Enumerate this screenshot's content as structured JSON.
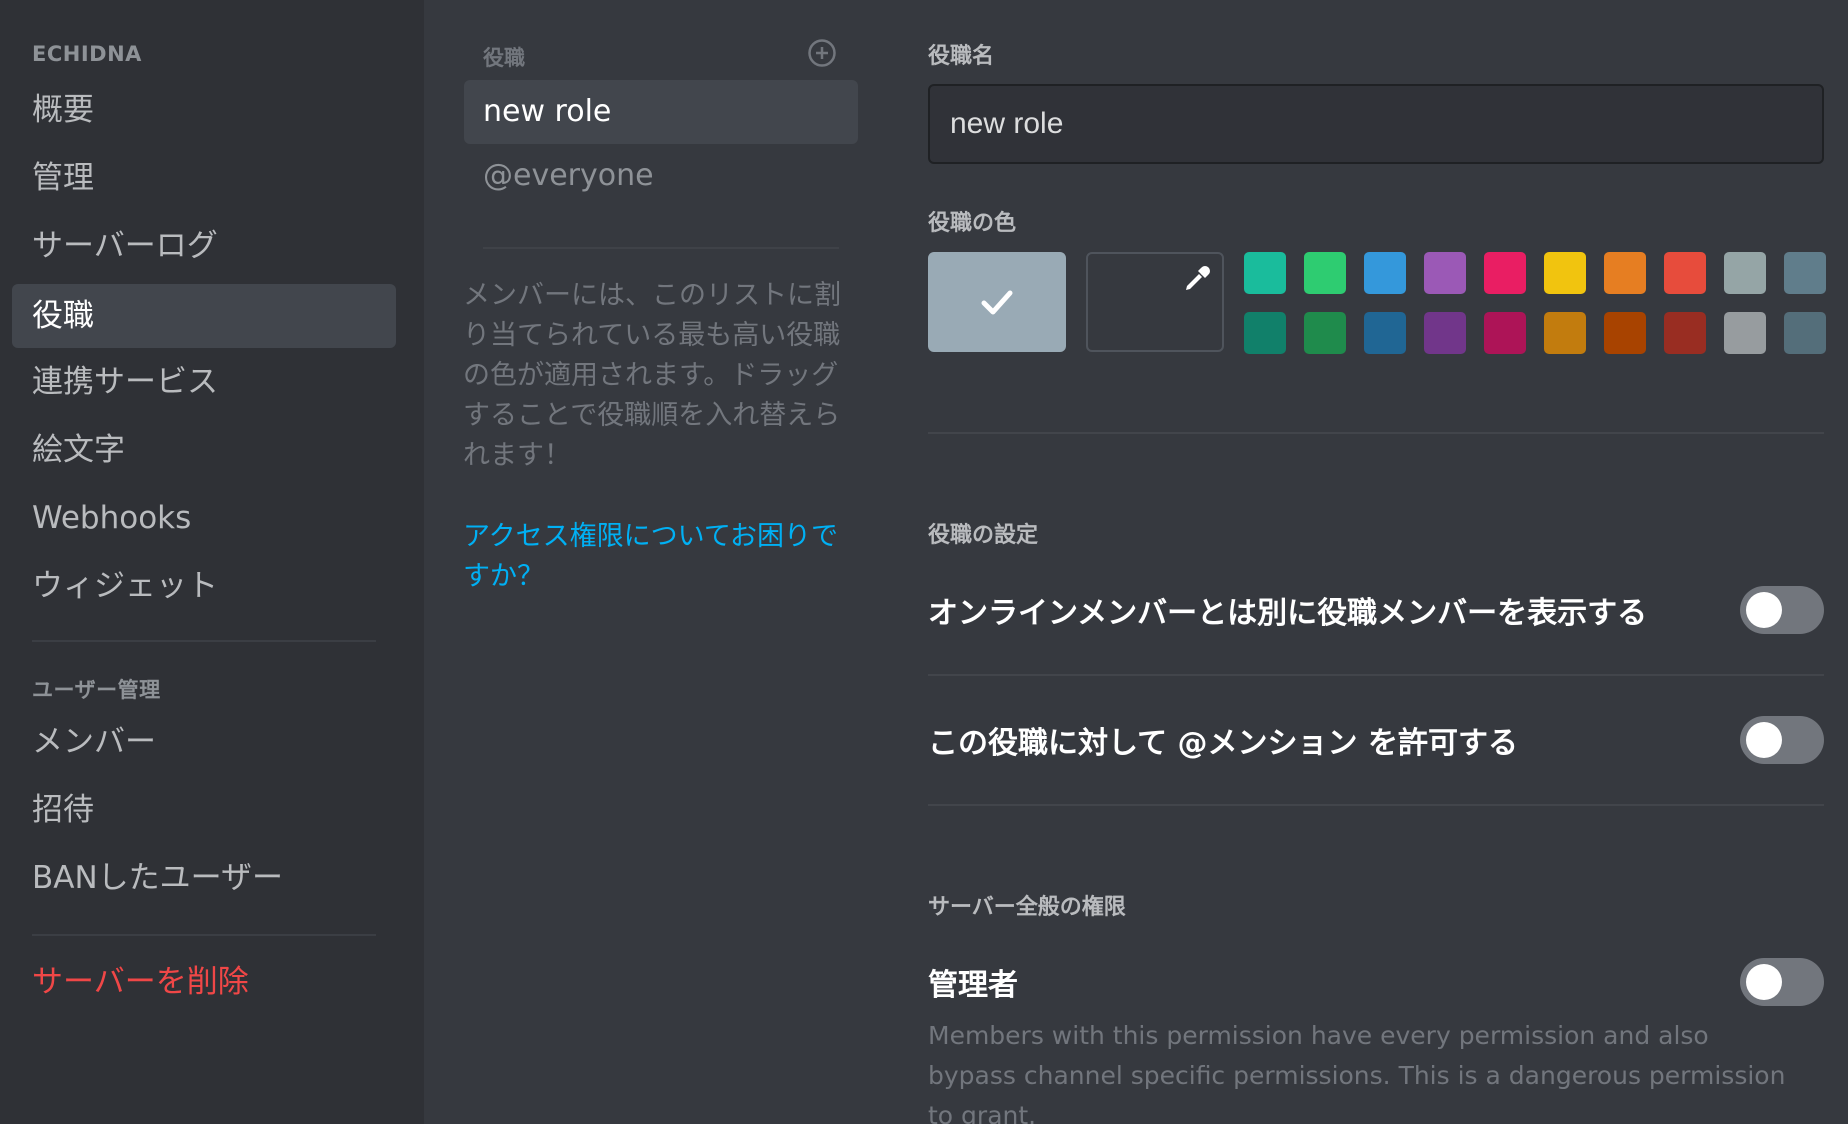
{
  "sidebar": {
    "server_name": "ECHIDNA",
    "items": [
      {
        "label": "概要"
      },
      {
        "label": "管理"
      },
      {
        "label": "サーバーログ"
      },
      {
        "label": "役職"
      },
      {
        "label": "連携サービス"
      },
      {
        "label": "絵文字"
      },
      {
        "label": "Webhooks"
      },
      {
        "label": "ウィジェット"
      }
    ],
    "user_section_header": "ユーザー管理",
    "user_items": [
      {
        "label": "メンバー"
      },
      {
        "label": "招待"
      },
      {
        "label": "BANしたユーザー"
      }
    ],
    "delete_server_label": "サーバーを削除",
    "active_item": "役職"
  },
  "roles": {
    "header": "役職",
    "add_icon": "plus-circle-icon",
    "list": [
      {
        "label": "new role",
        "selected": true
      },
      {
        "label": "@everyone",
        "selected": false
      }
    ],
    "info_text": "メンバーには、このリストに割り当てられている最も高い役職の色が適用されます。ドラッグすることで役職順を入れ替えられます！",
    "help_link": "アクセス権限についてお困りですか？"
  },
  "settings": {
    "name_label": "役職名",
    "name_value": "new role",
    "color_label": "役職の色",
    "default_swatch": {
      "color": "#99aab5",
      "icon": "checkmark-icon",
      "selected": true
    },
    "custom_swatch": {
      "icon": "eyedropper-icon"
    },
    "palette_row1": [
      "#1abc9c",
      "#2ecc71",
      "#3498db",
      "#9b59b6",
      "#e91e63",
      "#f1c40f",
      "#e67e22",
      "#e74c3c",
      "#95a5a6",
      "#607d8b"
    ],
    "palette_row2": [
      "#11806a",
      "#1f8b4c",
      "#206694",
      "#71368a",
      "#ad1457",
      "#c27c0e",
      "#a84300",
      "#992d22",
      "#979c9f",
      "#546e7a"
    ],
    "role_settings_header": "役職の設定",
    "toggle_display_separately": {
      "label": "オンラインメンバーとは別に役職メンバーを表示する",
      "on": false
    },
    "toggle_mentionable": {
      "label": "この役職に対して @メンション を許可する",
      "on": false
    },
    "general_permissions_header": "サーバー全般の権限",
    "administrator": {
      "label": "管理者",
      "on": false,
      "description": "Members with this permission have every permission and also bypass channel specific permissions. This is a dangerous permission to grant."
    }
  },
  "colors": {
    "danger": "#f04747",
    "link": "#00b0f4",
    "sidebar_bg": "#2f3136",
    "main_bg": "#36393f"
  }
}
